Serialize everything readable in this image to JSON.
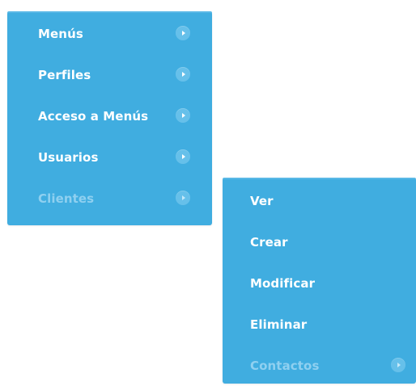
{
  "main_menu": {
    "items": [
      {
        "label": "Menús",
        "state": "normal"
      },
      {
        "label": "Perfiles",
        "state": "normal"
      },
      {
        "label": "Acceso a Menús",
        "state": "normal"
      },
      {
        "label": "Usuarios",
        "state": "normal"
      },
      {
        "label": "Clientes",
        "state": "dimmed"
      }
    ]
  },
  "submenu": {
    "items": [
      {
        "label": "Ver",
        "state": "normal"
      },
      {
        "label": "Crear",
        "state": "normal"
      },
      {
        "label": "Modificar",
        "state": "normal"
      },
      {
        "label": "Eliminar",
        "state": "normal"
      },
      {
        "label": "Contactos",
        "state": "dimmed"
      }
    ]
  },
  "colors": {
    "menu_background": "#40ade0",
    "item_text": "#ffffff",
    "dimmed_item_text": "#8fd0f0",
    "arrow_circle": "#66c0ea"
  },
  "icons": {
    "arrow": "chevron-right-circle-icon"
  }
}
